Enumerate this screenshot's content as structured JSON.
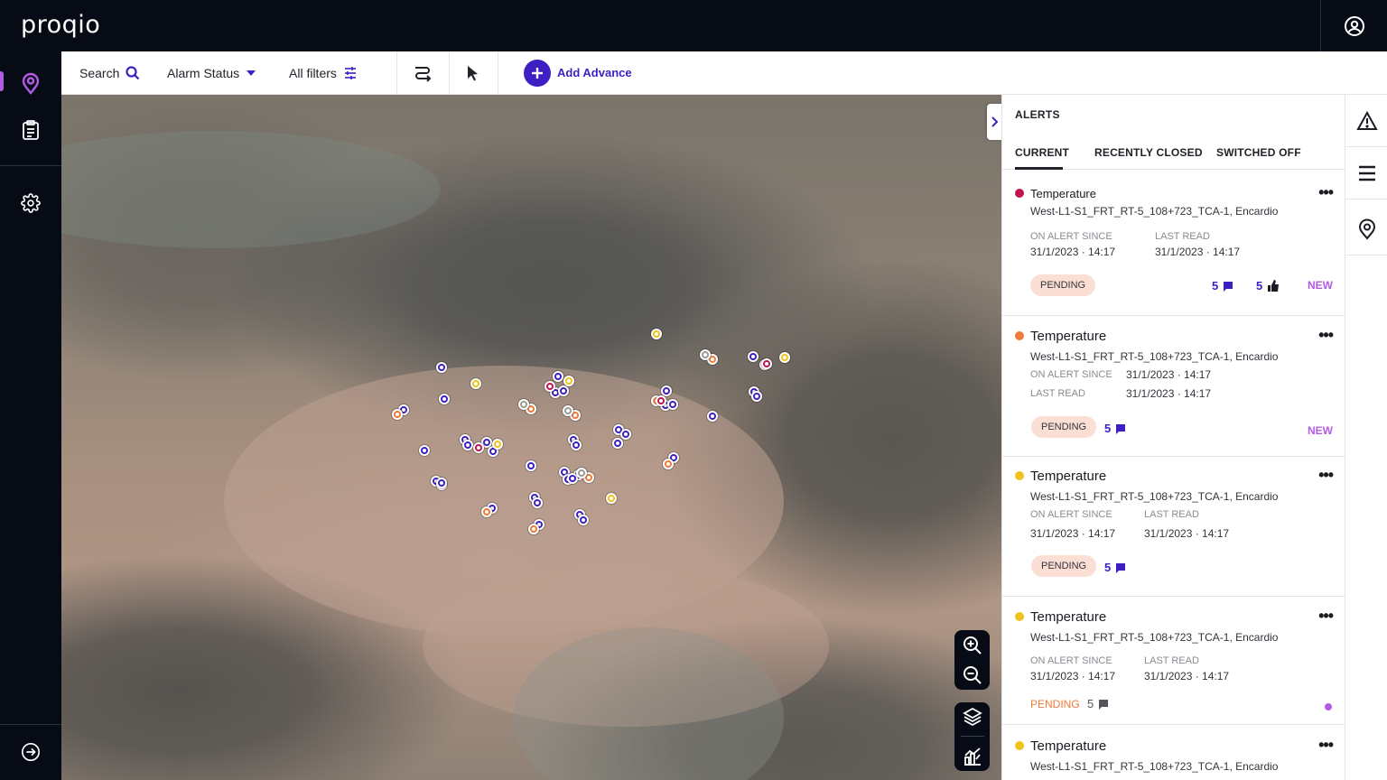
{
  "app": {
    "logo": "proqio"
  },
  "colors": {
    "accent": "#3d1fc4",
    "brand_purple": "#b45be6",
    "topbar": "#070b16",
    "alert_red": "#c0134f",
    "alert_orange": "#f07a3a",
    "alert_yellow": "#f1c21b",
    "pending_bg": "#fbdfd4"
  },
  "topbar": {
    "account_icon": "account-circle-icon"
  },
  "sidebar": {
    "items": [
      {
        "name": "map",
        "icon": "map-pin-icon",
        "active": true
      },
      {
        "name": "reports",
        "icon": "clipboard-icon",
        "active": false
      },
      {
        "name": "settings",
        "icon": "gear-icon",
        "active": false
      },
      {
        "name": "logout",
        "icon": "logout-icon",
        "active": false
      }
    ]
  },
  "toolbar": {
    "search_label": "Search",
    "alarm_status_label": "Alarm Status",
    "all_filters_label": "All filters",
    "route_icon": "route-icon",
    "select_icon": "cursor-icon",
    "add_advance_label": "Add Advance"
  },
  "map": {
    "zoom_in_icon": "zoom-in-icon",
    "zoom_out_icon": "zoom-out-icon",
    "layers_icon": "layers-icon",
    "chart_icon": "chart-icon",
    "sensor_status_counts": {
      "blue": 40,
      "yellow": 6,
      "orange": 10,
      "red": 4,
      "grey": 4
    }
  },
  "alerts_panel": {
    "title": "ALERTS",
    "tabs": [
      "CURRENT",
      "RECENTLY CLOSED",
      "SWITCHED OFF"
    ],
    "active_tab": "CURRENT",
    "cards": [
      {
        "severity": "red",
        "title": "Temperature",
        "sensor": "West-L1-S1_FRT_RT-5_108+723_TCA-1,  Encardio",
        "on_alert_label": "ON ALERT SINCE",
        "on_alert_value": "31/1/2023 · 14:17",
        "last_read_label": "LAST READ",
        "last_read_value": "31/1/2023 · 14:17",
        "status": "PENDING",
        "comments": "5",
        "likes": "5",
        "tag": "NEW"
      },
      {
        "severity": "orange",
        "title": "Temperature",
        "sensor": "West-L1-S1_FRT_RT-5_108+723_TCA-1,  Encardio",
        "on_alert_label": "ON ALERT SINCE",
        "on_alert_value": "31/1/2023 · 14:17",
        "last_read_label": "LAST READ",
        "last_read_value": "31/1/2023 · 14:17",
        "status": "PENDING",
        "comments": "5",
        "tag": "NEW"
      },
      {
        "severity": "yellow",
        "title": "Temperature",
        "sensor": "West-L1-S1_FRT_RT-5_108+723_TCA-1,  Encardio",
        "on_alert_label": "ON ALERT SINCE",
        "on_alert_value": "31/1/2023 · 14:17",
        "last_read_label": "LAST READ",
        "last_read_value": "31/1/2023 · 14:17",
        "status": "PENDING",
        "comments": "5"
      },
      {
        "severity": "yellow",
        "title": "Temperature",
        "sensor": "West-L1-S1_FRT_RT-5_108+723_TCA-1,  Encardio",
        "on_alert_label": "ON ALERT SINCE",
        "on_alert_value": "31/1/2023 · 14:17",
        "last_read_label": "LAST READ",
        "last_read_value": "31/1/2023 · 14:17",
        "status": "PENDING",
        "comments": "5"
      },
      {
        "severity": "yellow",
        "title": "Temperature",
        "sensor": "West-L1-S1_FRT_RT-5_108+723_TCA-1,  Encardio"
      }
    ]
  },
  "right_rail": {
    "items": [
      {
        "name": "alerts",
        "icon": "warning-icon"
      },
      {
        "name": "list",
        "icon": "menu-icon"
      },
      {
        "name": "locations",
        "icon": "location-pin-icon"
      }
    ]
  }
}
